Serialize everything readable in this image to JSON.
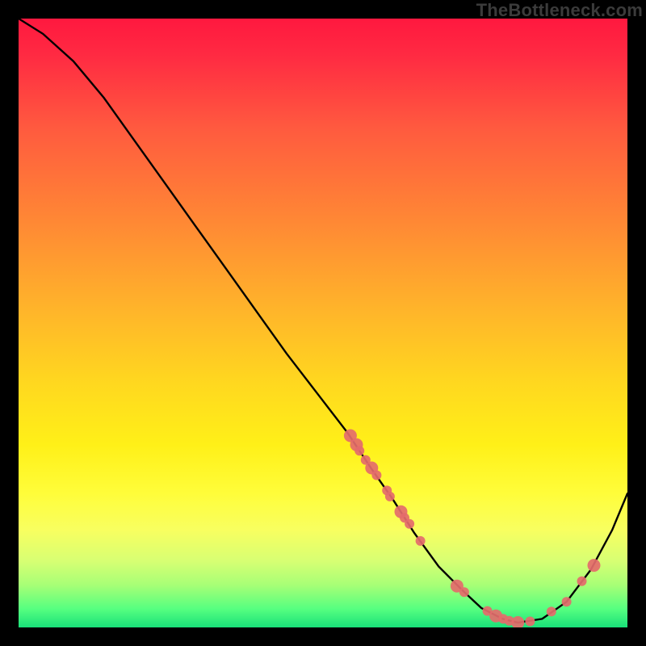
{
  "watermark": "TheBottleneck.com",
  "chart_data": {
    "type": "line",
    "title": "",
    "xlabel": "",
    "ylabel": "",
    "xlim": [
      0,
      100
    ],
    "ylim": [
      0,
      100
    ],
    "grid": false,
    "legend": false,
    "series": [
      {
        "name": "curve",
        "color": "#000000",
        "x": [
          0,
          4,
          9,
          14,
          19,
          24,
          29,
          34,
          39,
          44,
          49,
          54,
          58,
          61.5,
          65,
          69,
          73,
          76,
          79.5,
          82,
          86,
          90,
          94,
          97.5,
          100
        ],
        "y": [
          100,
          97.5,
          93,
          87,
          80,
          73,
          66,
          59,
          52,
          45,
          38.5,
          32,
          26,
          21,
          15.5,
          10,
          6,
          3.2,
          1.4,
          0.8,
          1.4,
          4.2,
          9.5,
          16,
          22
        ]
      }
    ],
    "scatter": {
      "name": "points",
      "color": "#e46b6b",
      "radius_small": 6,
      "radius_large": 8,
      "points": [
        {
          "x": 54.5,
          "y": 31.5,
          "r": "large"
        },
        {
          "x": 55.5,
          "y": 30,
          "r": "large"
        },
        {
          "x": 56,
          "y": 29,
          "r": "small"
        },
        {
          "x": 57,
          "y": 27.5,
          "r": "small"
        },
        {
          "x": 58,
          "y": 26.2,
          "r": "large"
        },
        {
          "x": 58.8,
          "y": 25,
          "r": "small"
        },
        {
          "x": 60.5,
          "y": 22.5,
          "r": "small"
        },
        {
          "x": 61,
          "y": 21.5,
          "r": "small"
        },
        {
          "x": 62.8,
          "y": 19,
          "r": "large"
        },
        {
          "x": 63.4,
          "y": 18,
          "r": "small"
        },
        {
          "x": 64.2,
          "y": 17,
          "r": "small"
        },
        {
          "x": 66,
          "y": 14.2,
          "r": "small"
        },
        {
          "x": 72,
          "y": 6.8,
          "r": "large"
        },
        {
          "x": 73.2,
          "y": 5.8,
          "r": "small"
        },
        {
          "x": 77,
          "y": 2.7,
          "r": "small"
        },
        {
          "x": 78.4,
          "y": 1.9,
          "r": "large"
        },
        {
          "x": 79.6,
          "y": 1.4,
          "r": "small"
        },
        {
          "x": 80.6,
          "y": 1.1,
          "r": "small"
        },
        {
          "x": 82,
          "y": 0.8,
          "r": "large"
        },
        {
          "x": 84,
          "y": 1.0,
          "r": "small"
        },
        {
          "x": 87.5,
          "y": 2.6,
          "r": "small"
        },
        {
          "x": 90,
          "y": 4.2,
          "r": "small"
        },
        {
          "x": 92.5,
          "y": 7.6,
          "r": "small"
        },
        {
          "x": 94.5,
          "y": 10.2,
          "r": "large"
        }
      ]
    }
  }
}
